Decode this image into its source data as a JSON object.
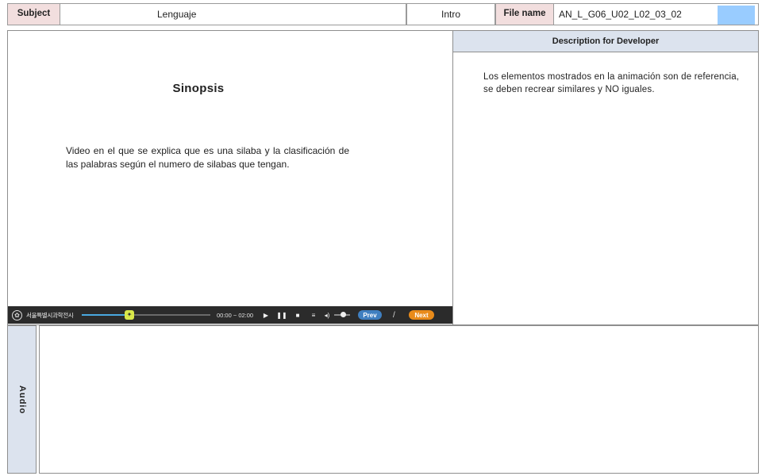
{
  "header": {
    "subject_label": "Subject",
    "subject_value": "Lenguaje",
    "section_value": "Intro",
    "filename_label": "File name",
    "filename_value": "AN_L_G06_U02_L02_03_02",
    "swatch_color": "#99ccff"
  },
  "stage": {
    "title": "Sinopsis",
    "body": "Video  en el que se explica que es una silaba y la clasificación de las palabras según el numero de silabas que tengan."
  },
  "player": {
    "org_name": "서울특별시과학전시관",
    "time": "00:00 ~ 02:00",
    "progress": 0.37,
    "volume": 0.5,
    "prev_label": "Prev",
    "separator": "/",
    "next_label": "Next",
    "icons": [
      "emblem-icon",
      "seek-thumb-icon",
      "play-icon",
      "pause-icon",
      "stop-icon",
      "menu-icon",
      "volume-icon"
    ]
  },
  "developer": {
    "heading": "Description for Developer",
    "text": "Los elementos mostrados en la animación son de referencia, se deben recrear similares y NO iguales."
  },
  "audio": {
    "label": "Audio"
  }
}
